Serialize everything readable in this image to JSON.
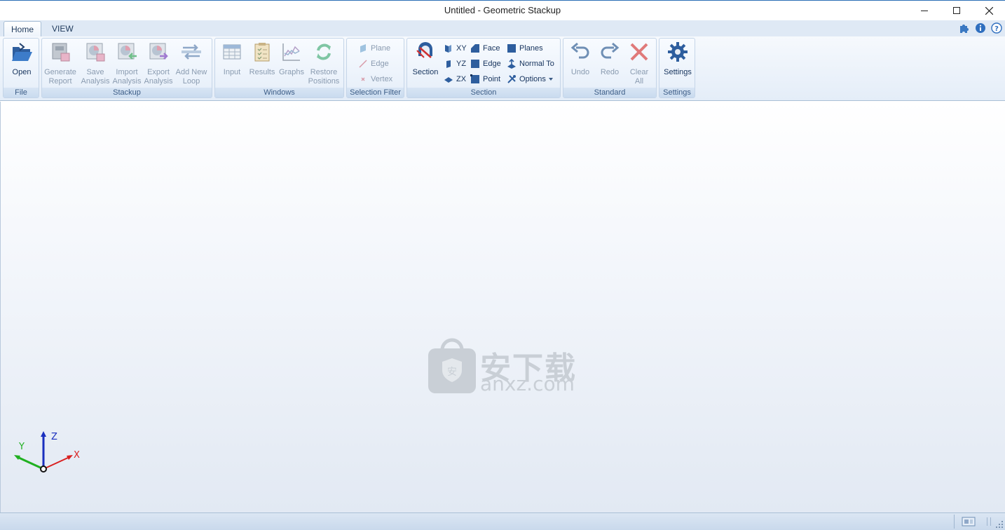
{
  "window": {
    "title": "Untitled - Geometric Stackup"
  },
  "tabs": [
    {
      "label": "Home",
      "active": true
    },
    {
      "label": "VIEW",
      "active": false
    }
  ],
  "ribbon": {
    "file": {
      "label": "File",
      "open": "Open"
    },
    "stackup": {
      "label": "Stackup",
      "generate_report": "Generate\nReport",
      "save_analysis": "Save\nAnalysis",
      "import_analysis": "Import\nAnalysis",
      "export_analysis": "Export\nAnalysis",
      "add_new_loop": "Add New\nLoop"
    },
    "windows": {
      "label": "Windows",
      "input": "Input",
      "results": "Results",
      "graphs": "Graphs",
      "restore_positions": "Restore\nPositions"
    },
    "selection_filter": {
      "label": "Selection Filter",
      "plane": "Plane",
      "edge": "Edge",
      "vertex": "Vertex"
    },
    "section": {
      "label": "Section",
      "section": "Section",
      "xy": "XY",
      "yz": "YZ",
      "zx": "ZX",
      "face": "Face",
      "edge": "Edge",
      "point": "Point",
      "planes": "Planes",
      "normal_to": "Normal To",
      "options": "Options"
    },
    "standard": {
      "label": "Standard",
      "undo": "Undo",
      "redo": "Redo",
      "clear_all": "Clear\nAll"
    },
    "settings": {
      "label": "Settings",
      "settings": "Settings"
    }
  },
  "viewport": {
    "axis_x": "X",
    "axis_y": "Y",
    "axis_z": "Z",
    "watermark_cn": "安下载",
    "watermark_url": "anxz.com"
  },
  "colors": {
    "accent": "#2b6fb5",
    "ribbon_bg": "#e4edf8",
    "axis_x": "#d92020",
    "axis_y": "#20b020",
    "axis_z": "#1a2fbf"
  }
}
